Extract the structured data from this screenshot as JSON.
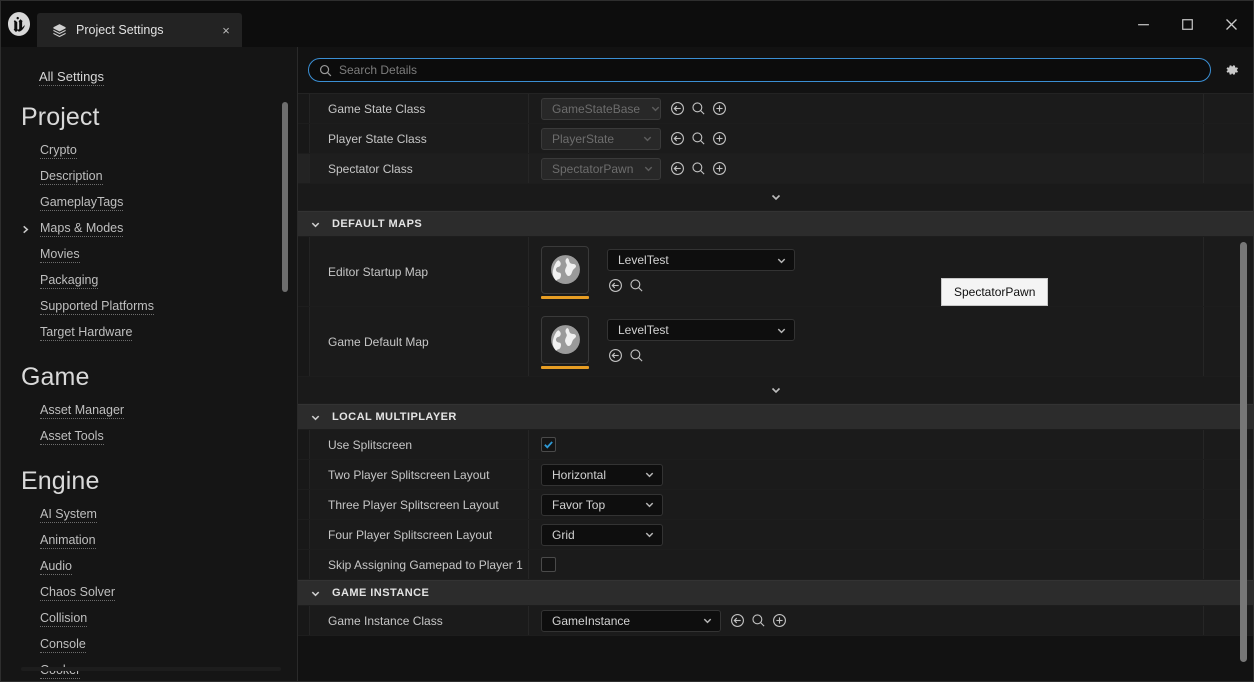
{
  "window": {
    "logo": "unreal-engine-logo",
    "tab": {
      "icon": "project-settings-icon",
      "title": "Project Settings",
      "close": "×"
    },
    "controls": {
      "minimize": "minimize-icon",
      "maximize": "maximize-icon",
      "close": "close-icon"
    }
  },
  "sidebar": {
    "all_settings": "All Settings",
    "sections": [
      {
        "title": "Project",
        "items": [
          {
            "label": "Crypto",
            "expandable": false
          },
          {
            "label": "Description",
            "expandable": false
          },
          {
            "label": "GameplayTags",
            "expandable": false
          },
          {
            "label": "Maps & Modes",
            "expandable": true
          },
          {
            "label": "Movies",
            "expandable": false
          },
          {
            "label": "Packaging",
            "expandable": false
          },
          {
            "label": "Supported Platforms",
            "expandable": false
          },
          {
            "label": "Target Hardware",
            "expandable": false
          }
        ]
      },
      {
        "title": "Game",
        "items": [
          {
            "label": "Asset Manager",
            "expandable": false
          },
          {
            "label": "Asset Tools",
            "expandable": false
          }
        ]
      },
      {
        "title": "Engine",
        "items": [
          {
            "label": "AI System",
            "expandable": false
          },
          {
            "label": "Animation",
            "expandable": false
          },
          {
            "label": "Audio",
            "expandable": false
          },
          {
            "label": "Chaos Solver",
            "expandable": false
          },
          {
            "label": "Collision",
            "expandable": false
          },
          {
            "label": "Console",
            "expandable": false
          },
          {
            "label": "Cooker",
            "expandable": false
          }
        ]
      }
    ]
  },
  "search": {
    "placeholder": "Search Details",
    "value": "",
    "icon": "search-icon",
    "settings_icon": "gear-icon"
  },
  "tooltip": {
    "text": "SpectatorPawn"
  },
  "details": {
    "class_rows": [
      {
        "name": "Game State Class",
        "value": "GameStateBase",
        "disabled": true
      },
      {
        "name": "Player State Class",
        "value": "PlayerState",
        "disabled": true
      },
      {
        "name": "Spectator Class",
        "value": "SpectatorPawn",
        "disabled": true
      }
    ],
    "sections": [
      {
        "label": "DEFAULT MAPS"
      },
      {
        "label": "LOCAL MULTIPLAYER"
      },
      {
        "label": "GAME INSTANCE"
      }
    ],
    "map_rows": [
      {
        "name": "Editor Startup Map",
        "value": "LevelTest",
        "thumb": "globe-icon"
      },
      {
        "name": "Game Default Map",
        "value": "LevelTest",
        "thumb": "globe-icon"
      }
    ],
    "multiplayer_rows": [
      {
        "name": "Use Splitscreen",
        "type": "checkbox",
        "checked": true
      },
      {
        "name": "Two Player Splitscreen Layout",
        "type": "dropdown",
        "value": "Horizontal"
      },
      {
        "name": "Three Player Splitscreen Layout",
        "type": "dropdown",
        "value": "Favor Top"
      },
      {
        "name": "Four Player Splitscreen Layout",
        "type": "dropdown",
        "value": "Grid"
      },
      {
        "name": "Skip Assigning Gamepad to Player 1",
        "type": "checkbox",
        "checked": false
      }
    ],
    "game_instance_row": {
      "name": "Game Instance Class",
      "value": "GameInstance"
    },
    "icons": {
      "reset": "reset-arrow-icon",
      "browse": "browse-magnifier-icon",
      "create": "create-plus-icon",
      "expander": "chevron-down-icon"
    }
  },
  "colors": {
    "accent_blue": "#3b8fd4",
    "thumb_underline": "#e79d23",
    "check_blue": "#2e9ad6"
  }
}
